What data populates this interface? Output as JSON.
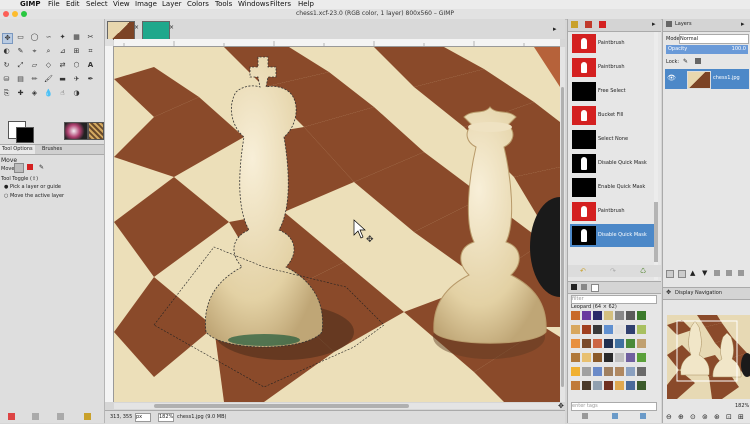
{
  "menu": {
    "app": "GIMP",
    "items": [
      "File",
      "Edit",
      "Select",
      "View",
      "Image",
      "Layer",
      "Colors",
      "Tools",
      "Windows",
      "Filters",
      "Help"
    ]
  },
  "window": {
    "title": "chess1.xcf-23.0 (RGB color, 1 layer) 800x560 – GIMP"
  },
  "toolbox": {
    "tabs": [
      "Tool Options",
      "Brushes"
    ],
    "tool_name": "Move",
    "move_label": "Move:",
    "tool_toggle": "Tool Toggle  (⇧)",
    "options": [
      "Pick a layer or guide",
      "Move the active layer"
    ]
  },
  "undo": {
    "items": [
      {
        "label": "Paintbrush",
        "thumb": "red"
      },
      {
        "label": "Paintbrush",
        "thumb": "red"
      },
      {
        "label": "Free Select",
        "thumb": "black"
      },
      {
        "label": "Bucket Fill",
        "thumb": "red"
      },
      {
        "label": "Select None",
        "thumb": "black"
      },
      {
        "label": "Disable Quick Mask",
        "thumb": "piece"
      },
      {
        "label": "Enable Quick Mask",
        "thumb": "black"
      },
      {
        "label": "Paintbrush",
        "thumb": "red"
      },
      {
        "label": "Disable Quick Mask",
        "thumb": "piece",
        "selected": true
      }
    ]
  },
  "brushes": {
    "filter_placeholder": "filter",
    "selected": "Leopard (64 × 62)",
    "tag_placeholder": "enter tags"
  },
  "layers": {
    "title": "Layers",
    "mode_label": "Mode",
    "mode_value": "Normal",
    "opacity_label": "Opacity",
    "opacity_value": "100.0",
    "lock_label": "Lock:",
    "layer_name": "chess1.jpg"
  },
  "navigation": {
    "title": "Display Navigation",
    "zoom": "182%"
  },
  "status": {
    "coords": "313, 355",
    "unit": "px",
    "zoom": "182%",
    "info": "chess1.jpg (9.0 MB)"
  },
  "colors": {
    "undo_selected": "#4c88c8",
    "thumb_red": "#d42020",
    "board_light": "#eadfb8",
    "board_dark": "#8a4a2a"
  }
}
